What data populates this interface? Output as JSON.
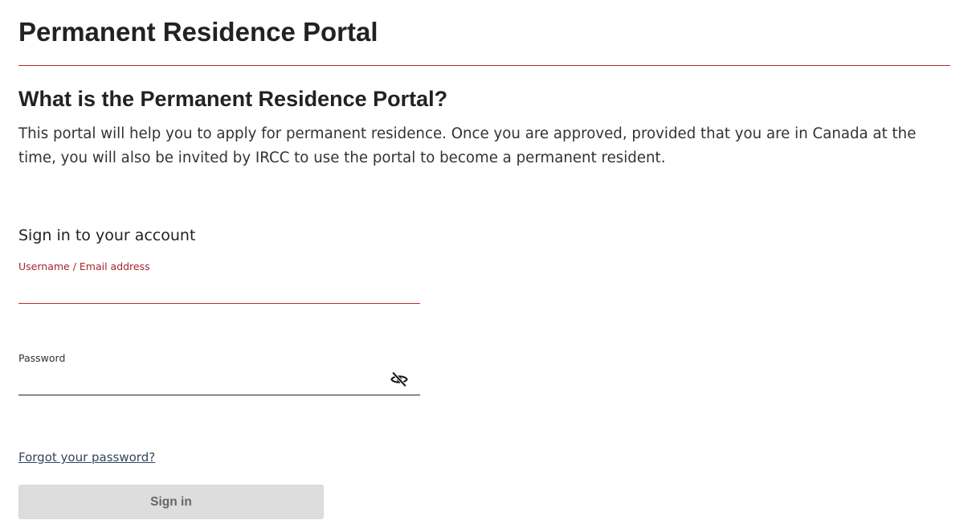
{
  "header": {
    "title": "Permanent Residence Portal"
  },
  "about": {
    "heading": "What is the Permanent Residence Portal?",
    "description": "This portal will help you to apply for permanent residence. Once you are approved, provided that you are in Canada at the time, you will also be invited by IRCC to use the portal to become a permanent resident."
  },
  "signin": {
    "heading": "Sign in to your account",
    "username_label": "Username / Email address",
    "username_value": "",
    "password_label": "Password",
    "password_value": "",
    "password_toggle_icon": "eye-slash-icon",
    "forgot_link": "Forgot your password?",
    "submit_label": "Sign in"
  },
  "colors": {
    "accent_red": "#c0272d",
    "label_red": "#a8232d",
    "link": "#33465c",
    "button_disabled_bg": "#dddddd",
    "button_disabled_text": "#666666"
  }
}
